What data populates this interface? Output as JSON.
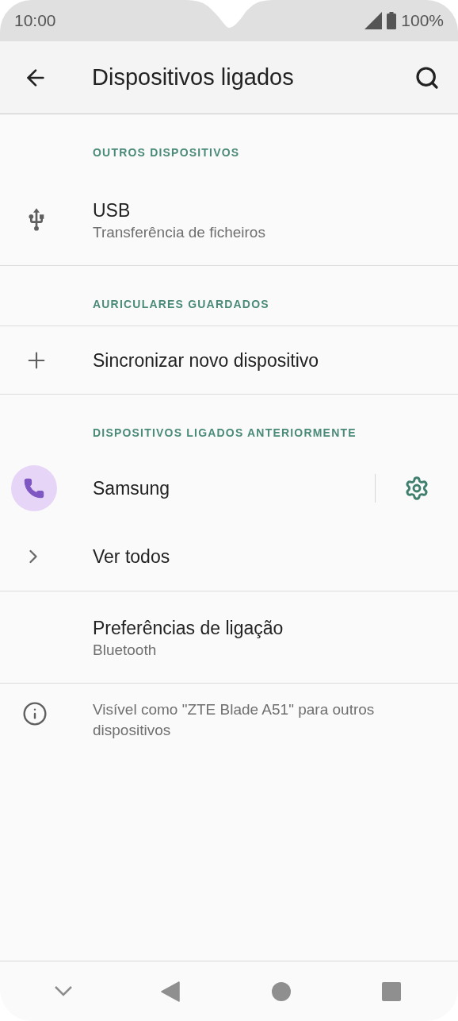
{
  "status_bar": {
    "time": "10:00",
    "battery": "100%"
  },
  "app_bar": {
    "title": "Dispositivos ligados"
  },
  "items": [
    {
      "kind": "header",
      "title": "OUTROS DISPOSITIVOS",
      "rule_below": false
    },
    {
      "kind": "usb",
      "title": "USB",
      "subtitle": "Transferência de ficheiros",
      "rule_below": true
    },
    {
      "kind": "header",
      "title": "AURICULARES GUARDADOS",
      "rule_below": true
    },
    {
      "kind": "add",
      "title": "Sincronizar novo dispositivo",
      "rule_below": true
    },
    {
      "kind": "header",
      "title": "DISPOSITIVOS LIGADOS ANTERIORMENTE",
      "rule_below": false
    },
    {
      "kind": "device",
      "title": "Samsung",
      "rule_below": false
    },
    {
      "kind": "more",
      "title": "Ver todos",
      "rule_below": true
    },
    {
      "kind": "plain",
      "title": "Preferências de ligação",
      "subtitle": "Bluetooth",
      "rule_below": true
    },
    {
      "kind": "info",
      "title": "Visível como \"ZTE Blade A51\" para outros dispositivos",
      "rule_below": false
    }
  ]
}
